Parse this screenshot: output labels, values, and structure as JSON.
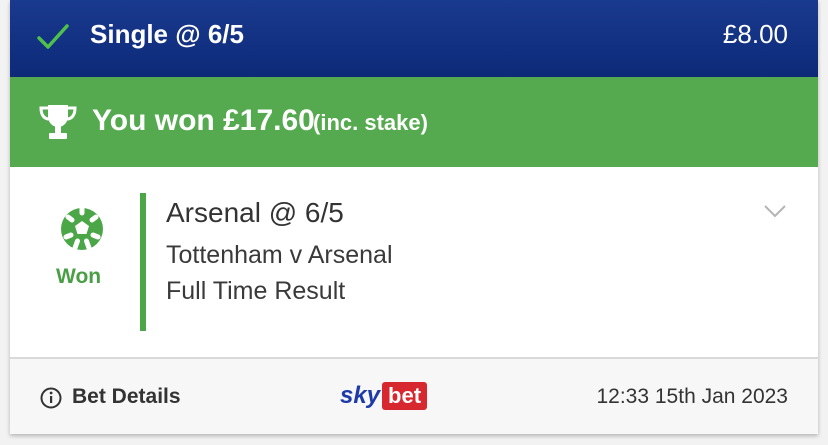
{
  "header": {
    "title": "Single @ 6/5",
    "stake": "£8.00"
  },
  "win_banner": {
    "text": "You won £17.60",
    "note": "(inc. stake)"
  },
  "selection": {
    "status": "Won",
    "pick": "Arsenal @ 6/5",
    "event": "Tottenham v Arsenal",
    "market": "Full Time Result",
    "icon": "football-icon"
  },
  "footer": {
    "details_label": "Bet Details",
    "brand_sky": "sky",
    "brand_bet": "bet",
    "timestamp": "12:33 15th Jan 2023"
  },
  "colors": {
    "header_blue": "#0d2a78",
    "win_green": "#55aa4f",
    "accent_green": "#4aa646",
    "brand_red": "#d6282e"
  }
}
